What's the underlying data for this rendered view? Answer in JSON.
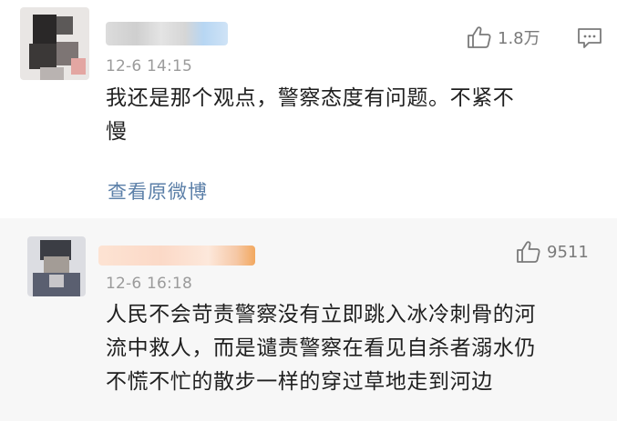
{
  "comments": [
    {
      "time": "12-6 14:15",
      "text_lines": [
        "我还是那个观点，警察态度有问题。不紧不",
        "慢"
      ],
      "likes": "1.8万",
      "view_original": "查看原微博",
      "like_icon": "thumbs-up-icon",
      "reply_icon": "comment-icon"
    },
    {
      "time": "12-6 16:18",
      "text_lines": [
        "人民不会苛责警察没有立即跳入冰冷刺骨的河",
        "流中救人，而是谴责警察在看见自杀者溺水仍",
        "不慌不忙的散步一样的穿过草地走到河边"
      ],
      "likes": "9511",
      "like_icon": "thumbs-up-icon"
    }
  ],
  "colors": {
    "link": "#5b7fa8",
    "meta": "#9b9b9b",
    "second_bg": "#f7f7f7"
  }
}
